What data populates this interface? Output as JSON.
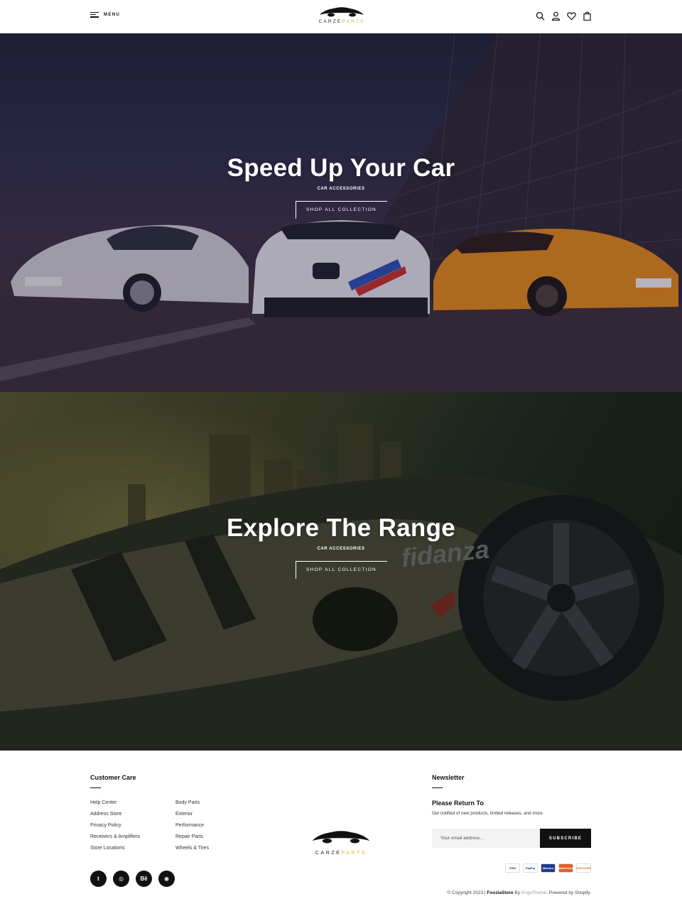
{
  "header": {
    "menu_label": "MENU",
    "logo": {
      "part1": "CARZE",
      "part2": "PARTS"
    },
    "icons": [
      "search-icon",
      "user-icon",
      "heart-icon",
      "bag-icon"
    ]
  },
  "banners": [
    {
      "title": "Speed Up Your Car",
      "subtitle": "CAR ACCESSORIES",
      "button": "SHOP ALL COLLECTION"
    },
    {
      "title": "Explore The Range",
      "subtitle": "CAR ACCESSORIES",
      "button": "SHOP ALL COLLECTION"
    }
  ],
  "footer": {
    "customer_care": {
      "heading": "Customer Care",
      "col1": [
        "Help Center",
        "Address Store",
        "Privacy Policy",
        "Receivers & Amplifiers",
        "Store Locations"
      ],
      "col2": [
        "Body Parts",
        "Exterior",
        "Performance",
        "Repair Parts",
        "Wheels & Tires"
      ]
    },
    "socials": [
      {
        "icon": "twitter-icon",
        "glyph": "t"
      },
      {
        "icon": "dribbble-icon",
        "glyph": "◎"
      },
      {
        "icon": "behance-icon",
        "glyph": "Bē"
      },
      {
        "icon": "instagram-icon",
        "glyph": "◉"
      }
    ],
    "logo": {
      "part1": "CARZE",
      "part2": "PARTS"
    },
    "newsletter": {
      "heading": "Newsletter",
      "title": "Please Return To",
      "description": "Get notified of new products, limited releases, and more.",
      "placeholder": "Your email address...",
      "button": "SUBSCRIBE"
    },
    "payments": [
      "VISA",
      "PayPal",
      "Maestro",
      "MasterCard",
      "DISCOVER"
    ],
    "copyright": {
      "prefix": "© Copyright 2023 | ",
      "store": "FooziaStore",
      "by": " By ",
      "theme": "EngoTheme",
      "suffix": ". Powered by Shopify."
    }
  },
  "colors": {
    "accent": "#e8b339",
    "dark": "#111111"
  }
}
